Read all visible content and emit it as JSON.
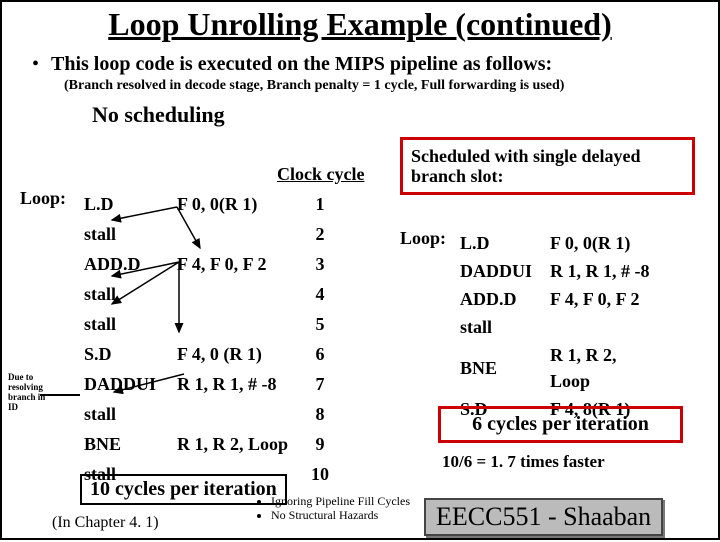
{
  "title": "Loop Unrolling Example (continued)",
  "bullet": "This loop code is executed on the MIPS pipeline as follows:",
  "note": "(Branch resolved in decode stage,  Branch penalty = 1 cycle,  Full forwarding is used)",
  "no_sched": "No scheduling",
  "clock_cycle": "Clock cycle",
  "loop_label": "Loop:",
  "table1": {
    "r0": {
      "i": "L.D",
      "a": "F 0, 0(R 1)",
      "c": "1"
    },
    "r1": {
      "i": "stall",
      "a": "",
      "c": "2"
    },
    "r2": {
      "i": "ADD.D",
      "a": "F 4, F 0, F 2",
      "c": "3"
    },
    "r3": {
      "i": "stall",
      "a": "",
      "c": "4"
    },
    "r4": {
      "i": "stall",
      "a": "",
      "c": "5"
    },
    "r5": {
      "i": "S.D",
      "a": "F 4, 0 (R 1)",
      "c": "6"
    },
    "r6": {
      "i": "DADDUI",
      "a": "R 1, R 1, # -8",
      "c": "7"
    },
    "r7": {
      "i": "stall",
      "a": "",
      "c": "8"
    },
    "r8": {
      "i": "BNE",
      "a": "R 1, R 2, Loop",
      "c": "9"
    },
    "r9": {
      "i": " stall",
      "a": "",
      "c": "10"
    }
  },
  "sidenote": "Due to resolving branch in ID",
  "redbox1": "Scheduled with single delayed branch slot:",
  "table2": {
    "r0": {
      "i": "L.D",
      "a": "F 0, 0(R 1)"
    },
    "r1": {
      "i": "DADDUI",
      "a": "R 1, R 1, # -8"
    },
    "r2": {
      "i": "ADD.D",
      "a": "F 4, F 0, F 2"
    },
    "r3": {
      "i": "stall",
      "a": ""
    },
    "r4": {
      "i": "BNE",
      "a": "R 1, R 2, Loop"
    },
    "r5": {
      "i": "S.D",
      "a": "F 4, 8(R 1)"
    }
  },
  "redbox2": "6 cycles per iteration",
  "bigbox1": "10 cycles per iteration",
  "faster": "10/6  =   1. 7   times faster",
  "chapref": "(In   Chapter 4. 1)",
  "notes": {
    "a": "Ignoring Pipeline Fill Cycles",
    "b": "No Structural Hazards"
  },
  "course": "EECC551 - Shaaban"
}
